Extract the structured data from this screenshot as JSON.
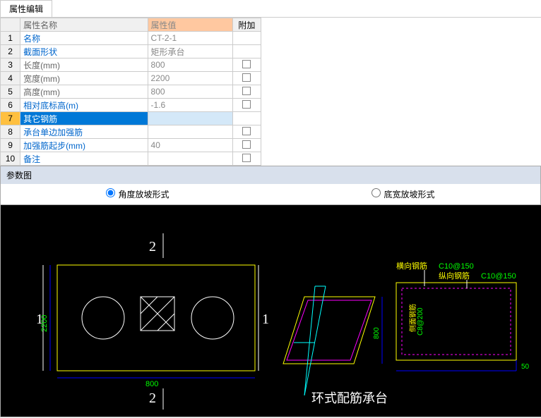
{
  "tab_label": "属性编辑",
  "headers": {
    "name": "属性名称",
    "value": "属性值",
    "add": "附加"
  },
  "rows": [
    {
      "num": "1",
      "name": "名称",
      "val": "CT-2-1",
      "link": true,
      "chk": false
    },
    {
      "num": "2",
      "name": "截面形状",
      "val": "矩形承台",
      "link": true,
      "chk": false
    },
    {
      "num": "3",
      "name": "长度(mm)",
      "val": "800",
      "link": false,
      "chk": true
    },
    {
      "num": "4",
      "name": "宽度(mm)",
      "val": "2200",
      "link": false,
      "chk": true
    },
    {
      "num": "5",
      "name": "高度(mm)",
      "val": "800",
      "link": false,
      "chk": true
    },
    {
      "num": "6",
      "name": "相对底标高(m)",
      "val": "-1.6",
      "link": true,
      "chk": true
    },
    {
      "num": "7",
      "name": "其它钢筋",
      "val": "",
      "link": true,
      "chk": false,
      "selected": true
    },
    {
      "num": "8",
      "name": "承台单边加强筋",
      "val": "",
      "link": true,
      "chk": true
    },
    {
      "num": "9",
      "name": "加强筋起步(mm)",
      "val": "40",
      "link": true,
      "chk": true
    },
    {
      "num": "10",
      "name": "备注",
      "val": "",
      "link": true,
      "chk": true
    }
  ],
  "panel_title": "参数图",
  "radio1": "角度放坡形式",
  "radio2": "底宽放坡形式",
  "diagram": {
    "dim1": "1",
    "dim2": "2",
    "w": "800",
    "h": "2200",
    "h2": "800",
    "h3": "50",
    "title": "环式配筋承台",
    "lbl_h": "横向钢筋",
    "lbl_h_v": "C10@150",
    "lbl_v": "纵向钢筋",
    "lbl_v_v": "C10@150",
    "lbl_s": "侧面钢筋",
    "lbl_s_v": "C8@200"
  }
}
